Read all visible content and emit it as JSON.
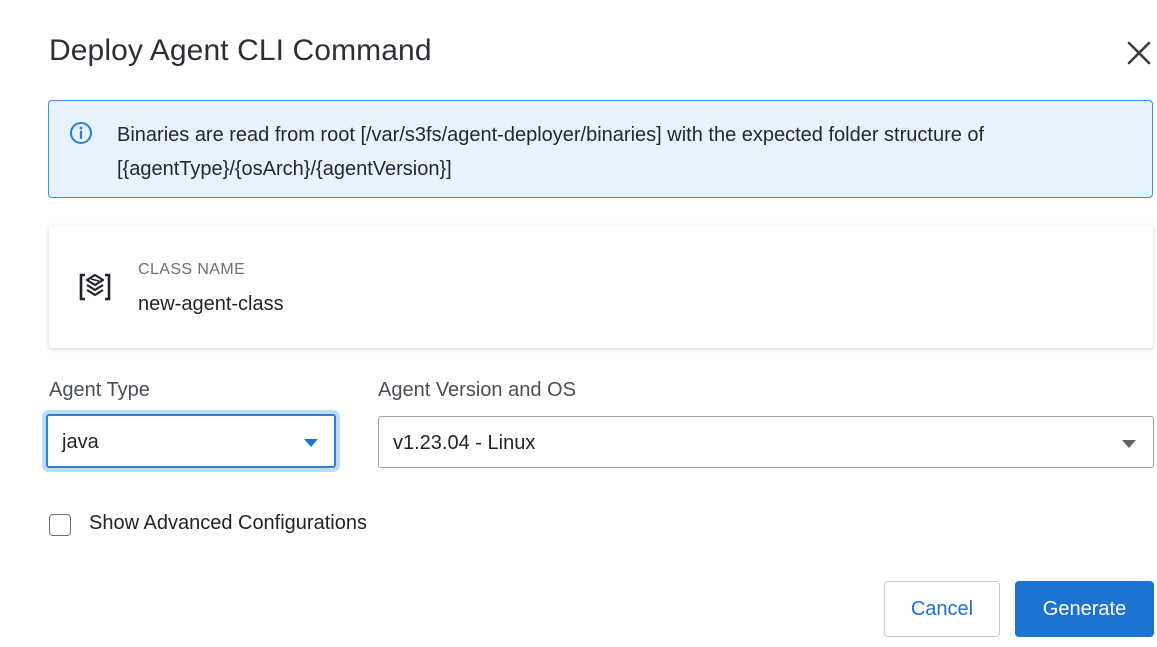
{
  "dialog": {
    "title": "Deploy Agent CLI Command",
    "close_icon": "close-icon"
  },
  "info_banner": {
    "icon": "info-icon",
    "text": "Binaries are read from root [/var/s3fs/agent-deployer/binaries] with the expected folder structure of [{agentType}/{osArch}/{agentVersion}]"
  },
  "class_card": {
    "icon": "agent-class-icon",
    "label": "CLASS NAME",
    "value": "new-agent-class"
  },
  "agent_type": {
    "label": "Agent Type",
    "value": "java"
  },
  "agent_version": {
    "label": "Agent Version and OS",
    "value": "v1.23.04 - Linux"
  },
  "advanced": {
    "label": "Show Advanced Configurations",
    "checked": false
  },
  "actions": {
    "cancel_label": "Cancel",
    "generate_label": "Generate"
  },
  "colors": {
    "primary": "#1d73d0",
    "banner_bg": "#e6f2fc",
    "banner_border": "#3d8fd9",
    "focus_ring": "#bfdcf7"
  }
}
